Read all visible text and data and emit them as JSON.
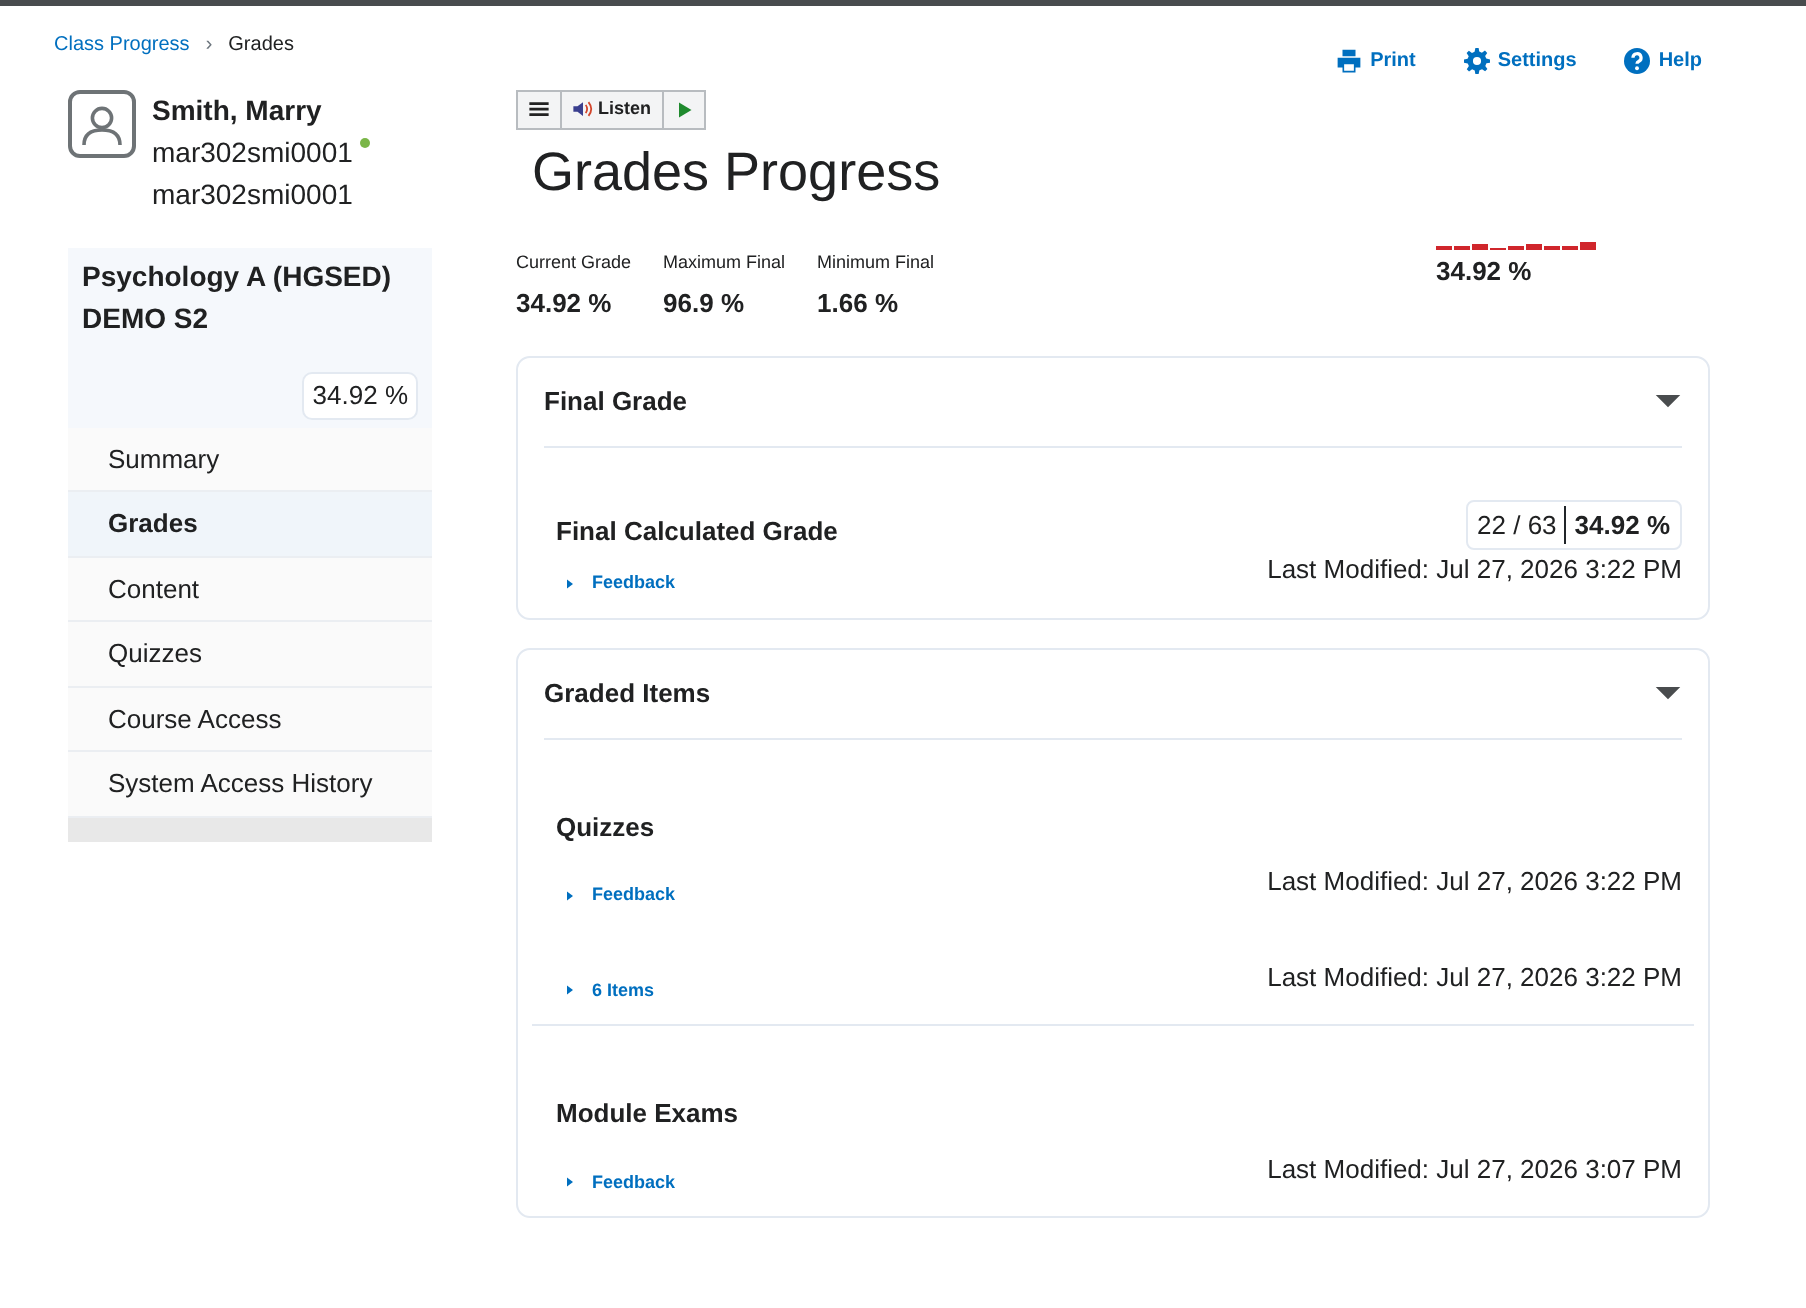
{
  "breadcrumb": [
    {
      "label": "Class Progress",
      "link": true
    },
    {
      "label": "Grades",
      "link": false
    }
  ],
  "breadcrumb_separator": "›",
  "toolbar": [
    "Print",
    "Settings",
    "Help"
  ],
  "user": {
    "name": "Smith, Marry",
    "username": "mar302smi0001",
    "online": true,
    "org_id": "mar302smi0001"
  },
  "course": {
    "title": "Psychology A (HGSED) DEMO S2",
    "grade": "34.92 %"
  },
  "sidebar": {
    "items": [
      {
        "label": "Summary",
        "selected": false
      },
      {
        "label": "Grades",
        "selected": true
      },
      {
        "label": "Content",
        "selected": false
      },
      {
        "label": "Quizzes",
        "selected": false
      },
      {
        "label": "Course Access",
        "selected": false
      },
      {
        "label": "System Access History",
        "selected": false
      }
    ]
  },
  "reader_toolbar": {
    "listen": "Listen"
  },
  "page_title": "Grades Progress",
  "stats": [
    {
      "label": "Current Grade",
      "value": "34.92 %"
    },
    {
      "label": "Maximum Final",
      "value": "96.9 %"
    },
    {
      "label": "Minimum Final",
      "value": "1.66 %"
    }
  ],
  "trend": {
    "value": "34.92 %"
  },
  "sections": [
    {
      "title": "Final Grade",
      "items": [
        {
          "name": "Final Calculated Grade",
          "score": "22 / 63",
          "percent": "34.92 %",
          "rows": [
            {
              "link": "Feedback",
              "modified": "Last Modified: Jul 27, 2026 3:22 PM"
            }
          ]
        }
      ]
    },
    {
      "title": "Graded Items",
      "items": [
        {
          "name": "Quizzes",
          "rows": [
            {
              "link": "Feedback",
              "modified": "Last Modified: Jul 27, 2026 3:22 PM"
            },
            {
              "link": "6 Items",
              "modified": "Last Modified: Jul 27, 2026 3:22 PM"
            }
          ]
        },
        {
          "name": "Module Exams",
          "rows": [
            {
              "link": "Feedback",
              "modified": "Last Modified: Jul 27, 2026 3:07 PM"
            }
          ]
        }
      ]
    }
  ]
}
